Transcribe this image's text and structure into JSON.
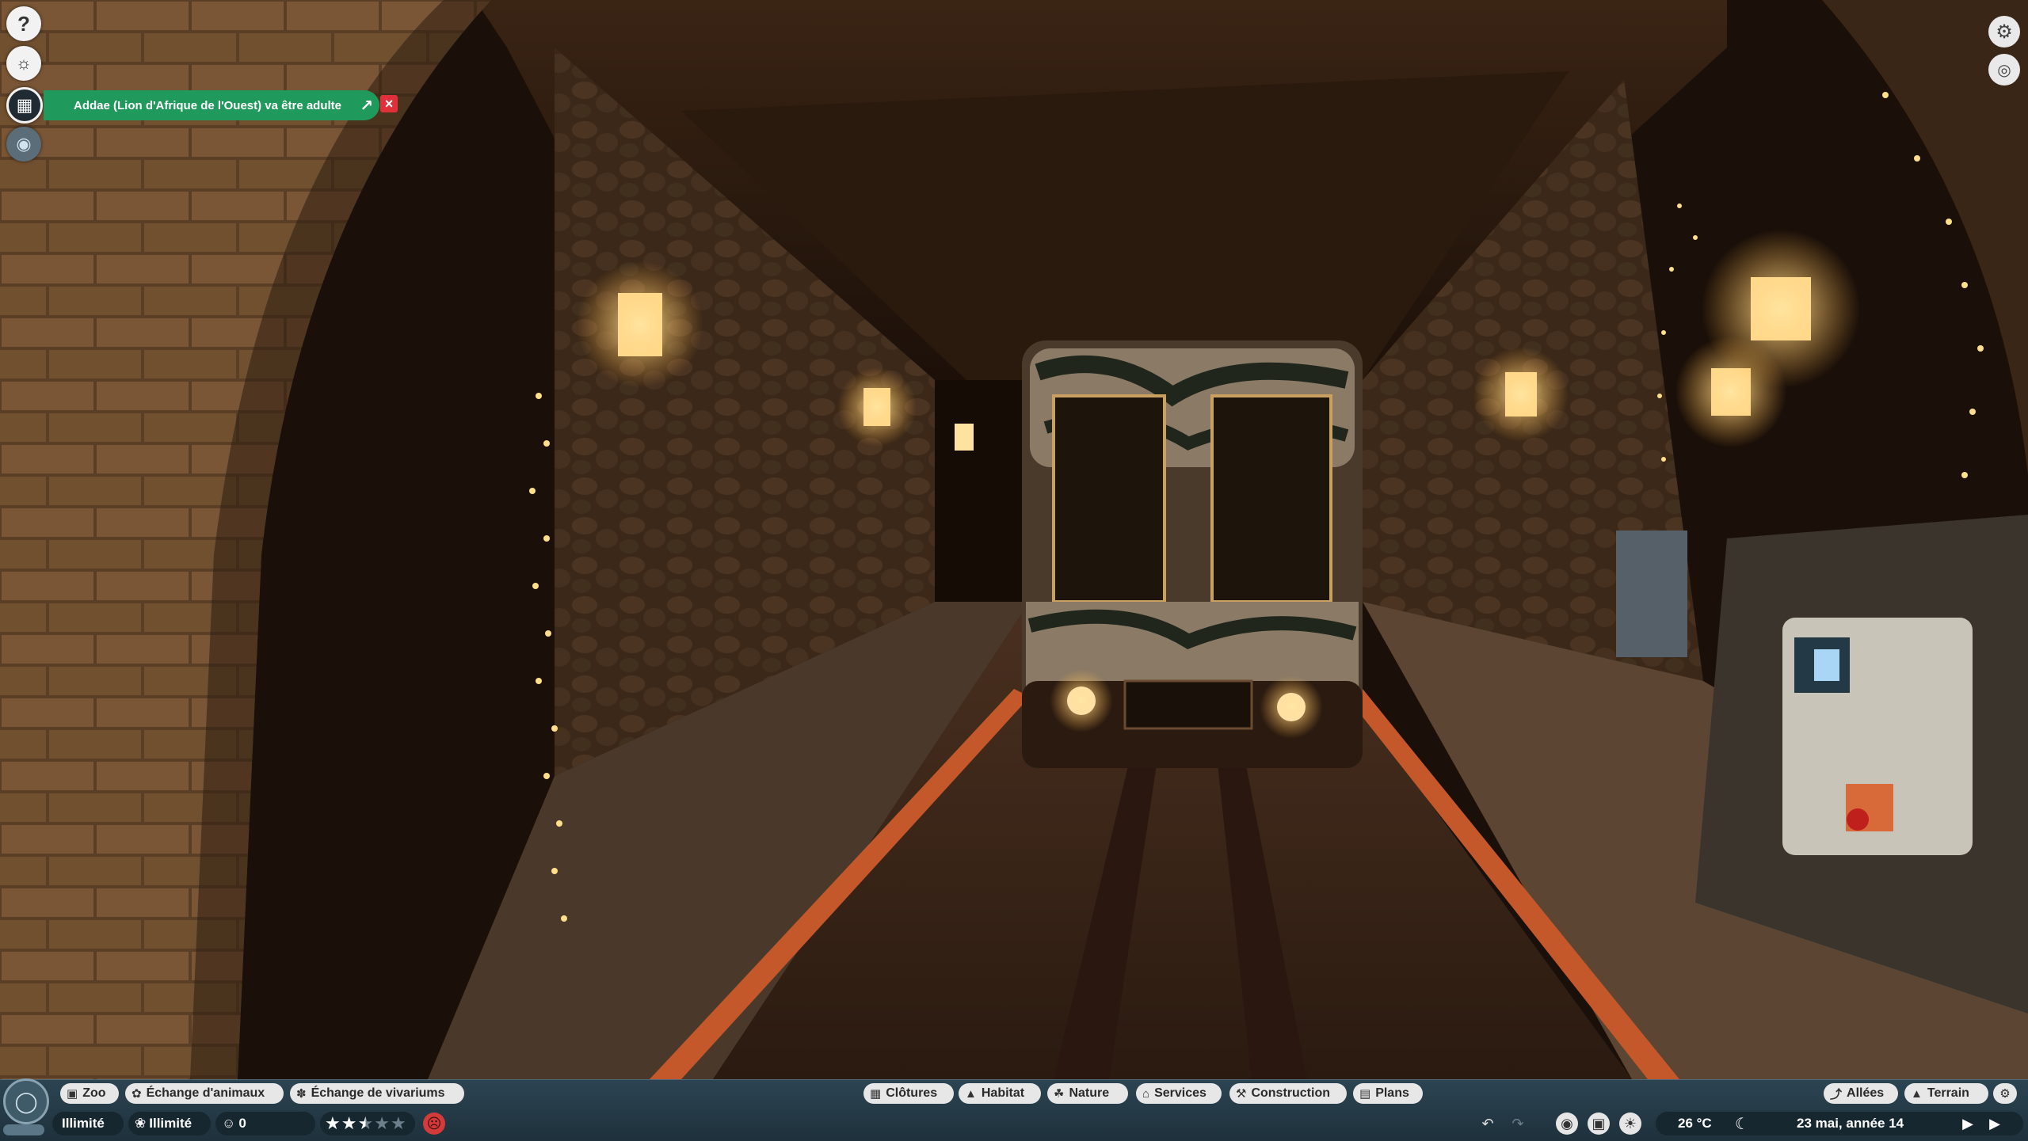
{
  "left_buttons": {
    "help_icon": "help-icon",
    "animals_icon": "animal-icon",
    "calendar_icon": "calendar-icon",
    "vision_icon": "eye-icon"
  },
  "notification": {
    "text": "Addae (Lion d'Afrique de l'Ouest) va être adulte",
    "open_icon": "external-link-icon",
    "close_icon": "close-icon"
  },
  "right_buttons": {
    "settings_icon": "gear-icon",
    "camera_icon": "camera-icon"
  },
  "toolbar_left": [
    {
      "label": "Zoo",
      "icon": "zoo-icon"
    },
    {
      "label": "Échange d'animaux",
      "icon": "paw-icon"
    },
    {
      "label": "Échange de vivariums",
      "icon": "bug-icon"
    }
  ],
  "toolbar_center": [
    {
      "label": "Clôtures",
      "icon": "fence-icon"
    },
    {
      "label": "Habitat",
      "icon": "habitat-icon"
    },
    {
      "label": "Nature",
      "icon": "tree-icon"
    },
    {
      "label": "Services",
      "icon": "shop-icon"
    },
    {
      "label": "Construction",
      "icon": "hammer-icon"
    },
    {
      "label": "Plans",
      "icon": "blueprint-icon"
    }
  ],
  "toolbar_right": [
    {
      "label": "Allées",
      "icon": "path-icon"
    },
    {
      "label": "Terrain",
      "icon": "terrain-icon"
    }
  ],
  "status": {
    "money": "Illimité",
    "research": "Illimité",
    "guests": "0",
    "rating_stars": 2.5,
    "rating_max": 5,
    "mood": "sad"
  },
  "time": {
    "temperature": "26 °C",
    "date": "23 mai, année 14"
  },
  "colors": {
    "hud": "#2c4452",
    "notification": "#1f9a5c",
    "close": "#e0303a",
    "mood_bad": "#d33a3a"
  }
}
